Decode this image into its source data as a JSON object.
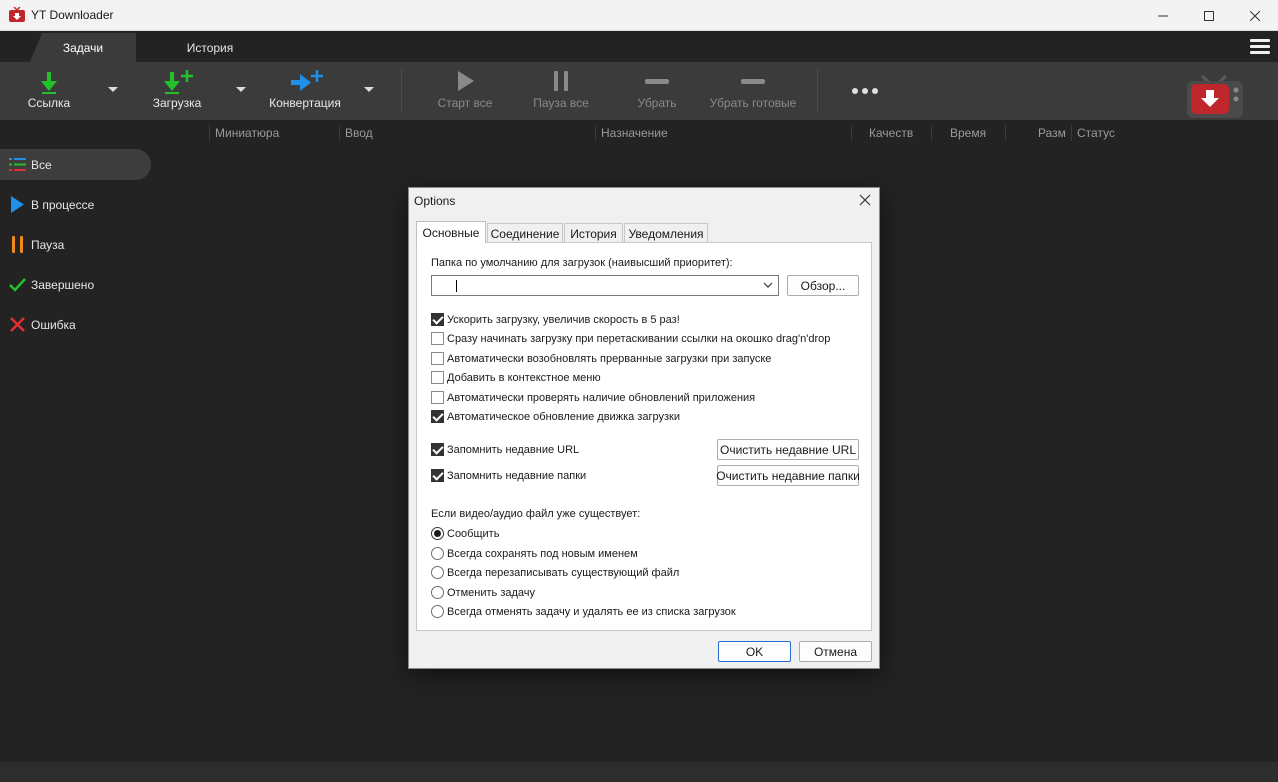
{
  "window": {
    "title": "YT Downloader"
  },
  "main_tabs": [
    {
      "label": "Задачи",
      "active": true
    },
    {
      "label": "История",
      "active": false
    }
  ],
  "toolbar": {
    "link": "Ссылка",
    "download": "Загрузка",
    "convert": "Конвертация",
    "start_all": "Старт все",
    "pause_all": "Пауза все",
    "remove": "Убрать",
    "remove_done": "Убрать готовые"
  },
  "columns": [
    "Миниатюра",
    "Ввод",
    "Назначение",
    "Качеств",
    "Время",
    "Разм",
    "Статус"
  ],
  "sidebar": {
    "items": [
      {
        "label": "Все",
        "icon": "list-icon",
        "active": true
      },
      {
        "label": "В процессе",
        "icon": "play-icon",
        "active": false
      },
      {
        "label": "Пауза",
        "icon": "pause-icon",
        "active": false
      },
      {
        "label": "Завершено",
        "icon": "check-icon",
        "active": false
      },
      {
        "label": "Ошибка",
        "icon": "error-icon",
        "active": false
      }
    ]
  },
  "dialog": {
    "title": "Options",
    "tabs": [
      "Основные",
      "Соединение",
      "История",
      "Уведомления"
    ],
    "active_tab": "Основные",
    "folder_label": "Папка по умолчанию для загрузок (наивысший приоритет):",
    "folder_value": "",
    "browse": "Обзор...",
    "options": [
      {
        "label": "Ускорить загрузку, увеличив скорость в 5 раз!",
        "checked": true
      },
      {
        "label": "Сразу начинать загрузку при перетаскивании ссылки на окошко drag'n'drop",
        "checked": false
      },
      {
        "label": "Автоматически возобновлять прерванные загрузки при запуске",
        "checked": false
      },
      {
        "label": "Добавить в контекстное меню",
        "checked": false
      },
      {
        "label": "Автоматически проверять наличие обновлений приложения",
        "checked": false
      },
      {
        "label": "Автоматическое обновление движка загрузки",
        "checked": true
      }
    ],
    "remember_url": {
      "label": "Запомнить недавние URL",
      "checked": true
    },
    "remember_folders": {
      "label": "Запомнить недавние папки",
      "checked": true
    },
    "clear_url": "Очистить недавние URL",
    "clear_folders": "Очистить недавние папки",
    "exists_label": "Если видео/аудио файл уже существует:",
    "exists_options": [
      {
        "label": "Сообщить",
        "selected": true
      },
      {
        "label": "Всегда сохранять под новым именем",
        "selected": false
      },
      {
        "label": "Всегда перезаписывать существующий файл",
        "selected": false
      },
      {
        "label": "Отменить задачу",
        "selected": false
      },
      {
        "label": "Всегда отменять задачу и удалять ее из списка загрузок",
        "selected": false
      }
    ],
    "ok": "OK",
    "cancel": "Отмена"
  },
  "colors": {
    "accent_green": "#22c02a",
    "accent_blue": "#1e90e8",
    "pause_orange": "#f08a1c",
    "error_red": "#e23030",
    "logo_red": "#c0272d"
  }
}
